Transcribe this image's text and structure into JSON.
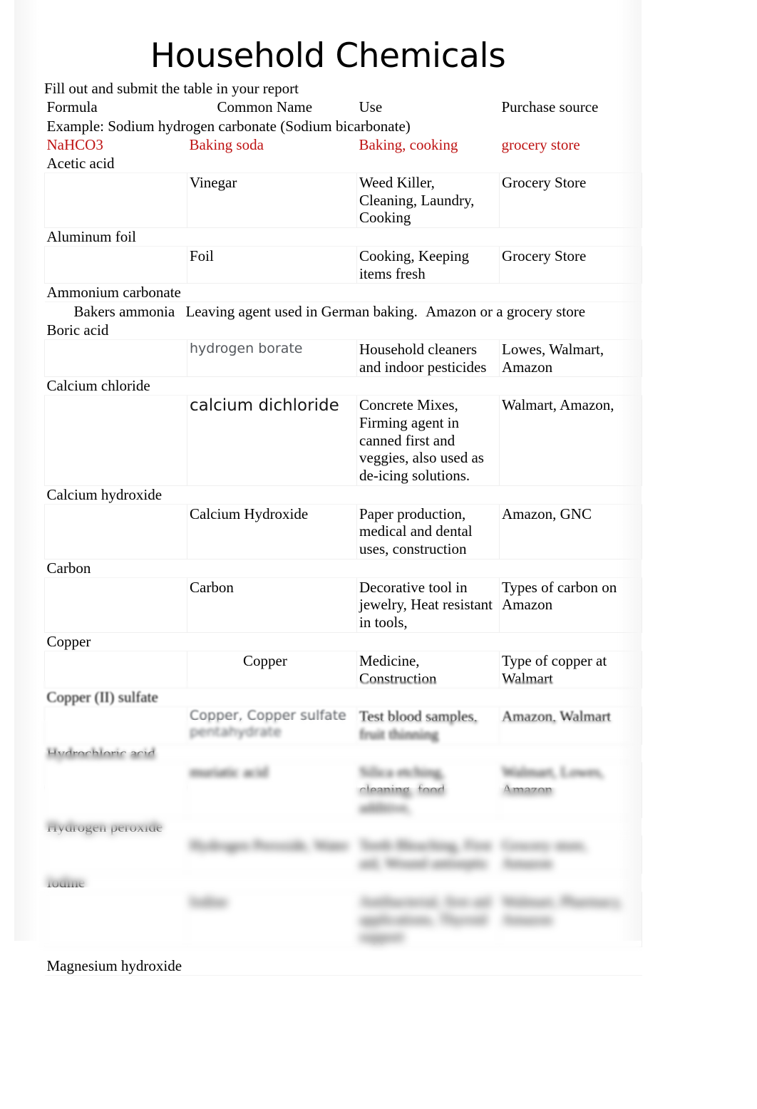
{
  "document": {
    "title": "Household Chemicals",
    "instruction": "Fill out and submit the table in your report"
  },
  "table": {
    "headers": {
      "formula": "Formula",
      "common_name": "Common Name",
      "use": "Use",
      "purchase_source": "Purchase source"
    },
    "example_note": "Example: Sodium hydrogen carbonate (Sodium bicarbonate)",
    "example_color": "#BE1212",
    "example": {
      "formula": "NaHCO3",
      "common_name": "Baking soda",
      "use": "Baking, cooking",
      "purchase_source": "grocery store"
    },
    "rows": [
      {
        "label": "Acetic acid",
        "formula": "",
        "common_name": "Vinegar",
        "use": "Weed Killer, Cleaning, Laundry, Cooking",
        "purchase_source": "Grocery Store",
        "style": "serif"
      },
      {
        "label": "Aluminum foil",
        "formula": "",
        "common_name": "Foil",
        "use": "Cooking, Keeping items fresh",
        "purchase_source": "Grocery Store",
        "style": "serif"
      },
      {
        "label": "Ammonium carbonate",
        "formula": "",
        "common_name": "Bakers ammonia",
        "use": "Leaving agent used in German baking.",
        "purchase_source": "Amazon or a grocery store",
        "style": "serif",
        "layout": "inline"
      },
      {
        "label": "Boric acid",
        "formula": "",
        "common_name": "hydrogen borate",
        "use": "Household cleaners and indoor pesticides",
        "purchase_source": "Lowes, Walmart, Amazon",
        "style": "sans-gray"
      },
      {
        "label": "Calcium chloride",
        "formula": "",
        "common_name": "calcium dichloride",
        "use": "Concrete Mixes, Firming agent in canned first and veggies, also used as de-icing solutions.",
        "purchase_source": "Walmart, Amazon,",
        "style": "sans-black"
      },
      {
        "label": "Calcium hydroxide",
        "formula": "",
        "common_name": "Calcium Hydroxide",
        "use": "Paper production, medical and dental uses, construction",
        "purchase_source": "Amazon, GNC",
        "style": "serif"
      },
      {
        "label": "Carbon",
        "formula": "",
        "common_name": "Carbon",
        "use": "Decorative tool in jewelry, Heat resistant in tools,",
        "purchase_source": "Types of carbon on Amazon",
        "style": "serif"
      },
      {
        "label": "Copper",
        "formula": "",
        "common_name": "Copper",
        "use": "Medicine, Construction",
        "purchase_source": "Type of copper at Walmart",
        "style": "serif",
        "common_indent": true
      },
      {
        "label": "Copper (II) sulfate",
        "formula": "",
        "common_name": "Copper, Copper sulfate pentahydrate",
        "use": "Test blood samples, fruit thinning",
        "purchase_source": "Amazon, Walmart",
        "style": "sans-gray"
      },
      {
        "label": "Hydrochloric acid",
        "formula": "",
        "common_name": "muriatic acid",
        "use": "Silica etching, cleaning, food additive,",
        "purchase_source": "Walmart, Lowes, Amazon",
        "style": "serif",
        "blurred": true
      },
      {
        "label": "Hydrogen peroxide",
        "formula": "",
        "common_name": "Hydrogen Peroxide, Water",
        "use": "Teeth Bleaching, First aid, Wound antiseptic",
        "purchase_source": "Grocery store, Amazon",
        "style": "serif",
        "blurred": true
      },
      {
        "label": "Iodine",
        "formula": "",
        "common_name": "Iodine",
        "use": "Antibacterial, first aid applications, Thyroid support",
        "purchase_source": "Walmart, Pharmacy, Amazon",
        "style": "serif",
        "blurred": true
      },
      {
        "label": "Magnesium hydroxide",
        "formula": "",
        "common_name": "",
        "use": "",
        "purchase_source": "",
        "style": "serif",
        "blurred": true,
        "label_only": true
      }
    ]
  }
}
